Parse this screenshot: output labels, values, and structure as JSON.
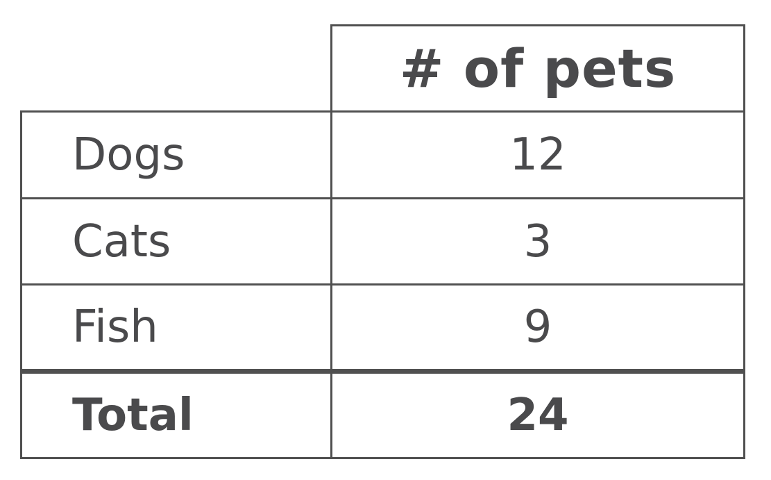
{
  "chart_data": {
    "type": "table",
    "column_header": "# of pets",
    "rows": [
      {
        "label": "Dogs",
        "value": "12"
      },
      {
        "label": "Cats",
        "value": "3"
      },
      {
        "label": "Fish",
        "value": "9"
      }
    ],
    "total": {
      "label": "Total",
      "value": "24"
    }
  }
}
